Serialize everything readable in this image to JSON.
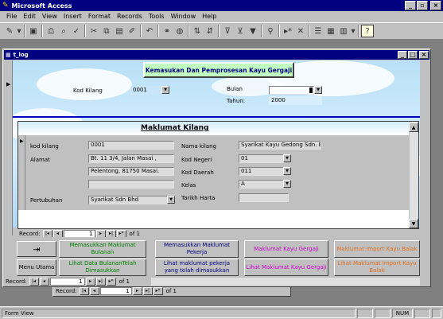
{
  "app": {
    "title": "Microsoft Access"
  },
  "menu": [
    "File",
    "Edit",
    "View",
    "Insert",
    "Format",
    "Records",
    "Tools",
    "Window",
    "Help"
  ],
  "window": {
    "title": "t_log"
  },
  "header": {
    "banner": "Kemasukan Dan Pemprosesan Kayu Gergaji"
  },
  "filter": {
    "kod_kilang_label": "Kod Kilang",
    "kod_kilang_value": "0001",
    "bulan_label": "Bulan",
    "bulan_value": "",
    "tahun_label": "Tahun:",
    "tahun_value": "2000"
  },
  "subform": {
    "title": "Maklumat Kilang",
    "kod_kilang_label": "kod kilang",
    "kod_kilang_value": "0001",
    "alamat_label": "Alamat",
    "alamat_1": "Bt. 11 3/4, Jalan Masai ,",
    "alamat_2": "Pelentong, 81750 Masai.",
    "alamat_3": "",
    "pertubuhan_label": "Pertubuhan",
    "pertubuhan_value": "Syarikat Sdn Bhd",
    "nama_kilang_label": "Nama kilang",
    "nama_kilang_value": "Syarikat Kayu Gedong Sdn. B",
    "kod_negeri_label": "Kod Negeri",
    "kod_negeri_value": "01",
    "kod_daerah_label": "Kod Daerah",
    "kod_daerah_value": "011",
    "kelas_label": "Kelas",
    "kelas_value": "A",
    "tarikh_harta_label": "Tarikh Harta",
    "tarikh_harta_value": ""
  },
  "record_nav_sub": {
    "label": "Record:",
    "current": "1",
    "of": "of  1"
  },
  "buttons": {
    "menu_utama": "Menu Utama",
    "masukkan_bulanan": "Memasukkan Maklumat Bulanan",
    "lihat_bulanan": "Lihat Data BulananTelah Dimasukkan",
    "masukkan_pekerja": "Memasukkan Maklumat Pekerja",
    "lihat_pekerja": "Lihat maklumat pekerja yang telah dimasukkan",
    "maklumat_kayu": "Maklumat Kayu Gergaji",
    "lihat_kayu": "Lihat Maklumat Kayu Gergaji",
    "import_1": "Maklumat Import Kayu Balak",
    "import_2": "Lihat Maklumat Import Kayu Balak"
  },
  "colors": {
    "green": "#008000",
    "blue": "#000080",
    "magenta": "#cc00cc",
    "orange": "#e07020",
    "banner_bg": "#c0ffc0"
  },
  "record_nav_main": {
    "label": "Record:",
    "current": "1",
    "of": "of  1"
  },
  "record_nav_back": {
    "label": "Record:",
    "current": "1",
    "of": "of  1"
  },
  "status": {
    "left": "Form View",
    "num": "NUM"
  }
}
